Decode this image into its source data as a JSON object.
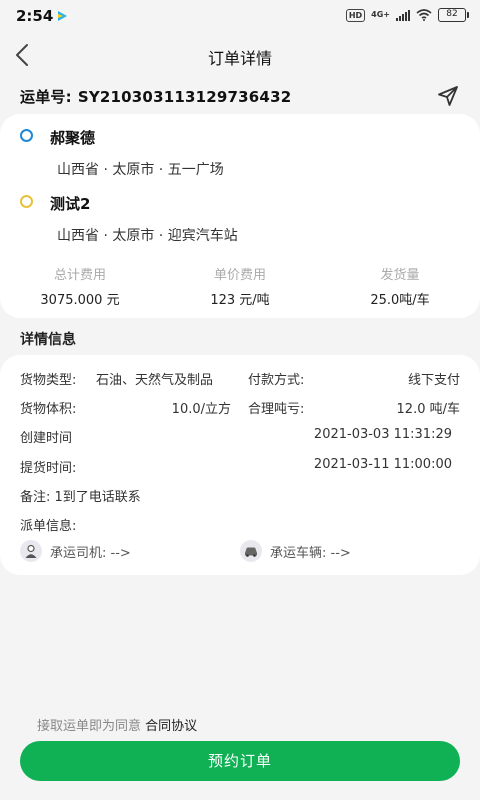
{
  "status_bar": {
    "time": "2:54",
    "hd": "HD",
    "network": "4G+",
    "battery": "82"
  },
  "header": {
    "title": "订单详情"
  },
  "waybill": {
    "label": "运单号:",
    "number": "SY210303113129736432"
  },
  "route": {
    "origin": {
      "name": "郝聚德",
      "address": "山西省 · 太原市 · 五一广场",
      "color": "#1e88d6"
    },
    "destination": {
      "name": "测试2",
      "address": "山西省 · 太原市 · 迎宾汽车站",
      "color": "#e8c23a"
    }
  },
  "stats": [
    {
      "label": "总计费用",
      "value": "3075.000 元"
    },
    {
      "label": "单价费用",
      "value": "123 元/吨"
    },
    {
      "label": "发货量",
      "value": "25.0吨/车"
    }
  ],
  "details": {
    "title": "详情信息",
    "cargo_type_label": "货物类型:",
    "cargo_type_value": "石油、天然气及制品",
    "payment_label": "付款方式:",
    "payment_value": "线下支付",
    "volume_label": "货物体积:",
    "volume_value": "10.0/立方",
    "loss_label": "合理吨亏:",
    "loss_value": "12.0 吨/车",
    "created_label": "创建时间",
    "created_value": "2021-03-03 11:31:29",
    "pickup_label": "提货时间:",
    "pickup_value": "2021-03-11 11:00:00",
    "remark": "备注: 1到了电话联系",
    "dispatch_label": "派单信息:",
    "driver_label": "承运司机: -->",
    "vehicle_label": "承运车辆: -->"
  },
  "footer": {
    "agree_text": "接取运单即为同意",
    "agreement_link": "合同协议",
    "book_button": "预约订单",
    "accent": "#10b055"
  }
}
